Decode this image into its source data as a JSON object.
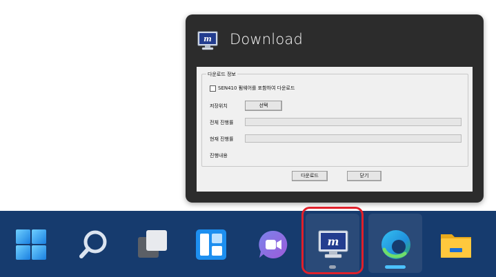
{
  "preview": {
    "title": "Download",
    "icon": "monitor-app-icon"
  },
  "dialog": {
    "group_title": "다운로드 정보",
    "checkbox_label": "SEN410 펌웨어를 포함하여 다운로드",
    "checkbox_checked": false,
    "save_location_label": "저장위치",
    "select_button_label": "선택",
    "total_progress_label": "전체 진행률",
    "current_progress_label": "현재 진행률",
    "progress_content_label": "진행내용",
    "download_button_label": "다운로드",
    "close_button_label": "닫기"
  },
  "taskbar": {
    "items": [
      {
        "name": "start",
        "icon": "windows-start-icon"
      },
      {
        "name": "search",
        "icon": "search-icon"
      },
      {
        "name": "task-view",
        "icon": "task-view-icon"
      },
      {
        "name": "widgets",
        "icon": "widgets-icon"
      },
      {
        "name": "teams-chat",
        "icon": "teams-chat-icon"
      },
      {
        "name": "download-app",
        "icon": "monitor-app-icon",
        "active": true
      },
      {
        "name": "edge",
        "icon": "edge-icon",
        "running": true
      },
      {
        "name": "file-explorer",
        "icon": "folder-icon"
      }
    ]
  },
  "colors": {
    "taskbar": "#163b6e",
    "preview_bg": "#2c2c2c",
    "highlight": "#e0202a",
    "running_indicator": "#4cc2ff"
  }
}
